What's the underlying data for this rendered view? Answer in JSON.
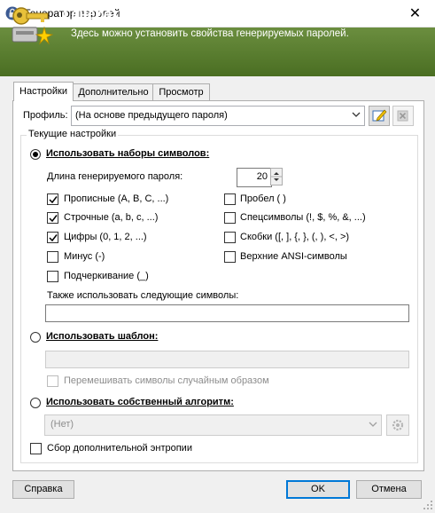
{
  "window": {
    "title": "Генератор паролей",
    "close_symbol": "✕"
  },
  "banner": {
    "title": "Генератор паролей",
    "subtitle": "Здесь можно установить свойства генерируемых паролей."
  },
  "tabs": [
    {
      "label": "Настройки",
      "active": true
    },
    {
      "label": "Дополнительно",
      "active": false
    },
    {
      "label": "Просмотр",
      "active": false
    }
  ],
  "profile": {
    "label": "Профиль:",
    "value": "(На основе предыдущего пароля)"
  },
  "group": {
    "legend": "Текущие настройки",
    "charset_radio": {
      "label": "Использовать наборы символов:",
      "checked": true
    },
    "length": {
      "label": "Длина генерируемого пароля:",
      "value": "20"
    },
    "charsets_left": [
      {
        "label": "Прописные (A, B, C, ...)",
        "checked": true
      },
      {
        "label": "Строчные (a, b, c, ...)",
        "checked": true
      },
      {
        "label": "Цифры (0, 1, 2, ...)",
        "checked": true
      },
      {
        "label": "Минус (-)",
        "checked": false
      },
      {
        "label": "Подчеркивание (_)",
        "checked": false
      }
    ],
    "charsets_right": [
      {
        "label": "Пробел ( )",
        "checked": false
      },
      {
        "label": "Спецсимволы (!, $, %, &, ...)",
        "checked": false
      },
      {
        "label": "Скобки ([, ], {, }, (, ), <, >)",
        "checked": false
      },
      {
        "label": "Верхние ANSI-символы",
        "checked": false
      }
    ],
    "also_use_label": "Также использовать следующие символы:",
    "also_use_value": "",
    "pattern_radio": {
      "label": "Использовать шаблон:",
      "checked": false
    },
    "pattern_value": "",
    "shuffle": {
      "label": "Перемешивать символы случайным образом",
      "checked": false
    },
    "algo_radio": {
      "label": "Использовать собственный алгоритм:",
      "checked": false
    },
    "algo_value": "(Нет)",
    "entropy": {
      "label": "Сбор дополнительной энтропии",
      "checked": false
    }
  },
  "buttons": {
    "help": "Справка",
    "ok": "OK",
    "cancel": "Отмена"
  },
  "colors": {
    "banner": "#5a7e30",
    "ok_border": "#0078d7"
  }
}
